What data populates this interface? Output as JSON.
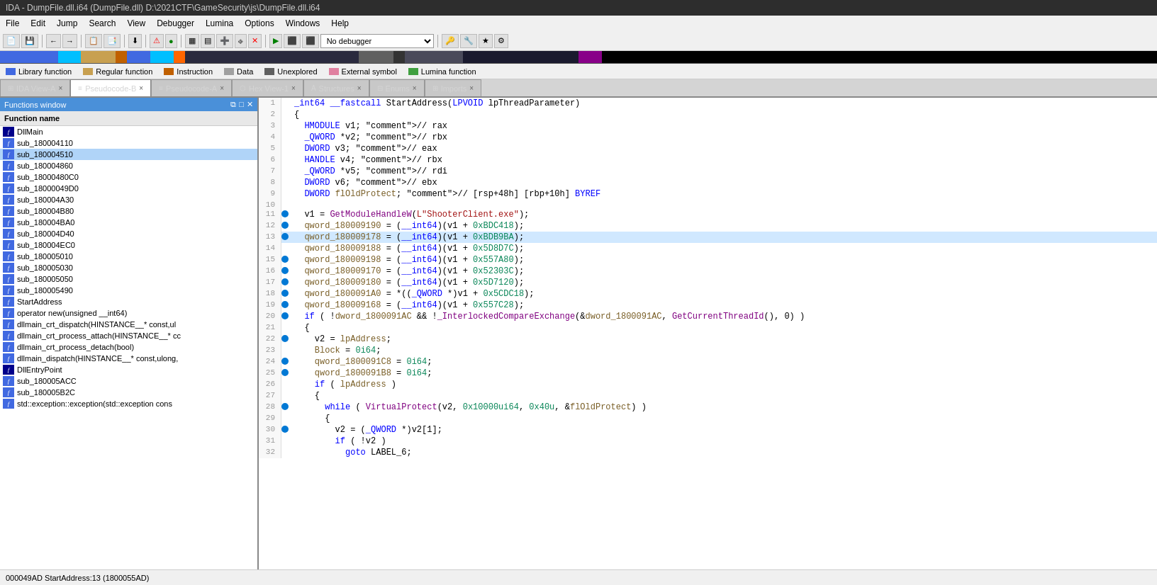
{
  "title": "IDA - DumpFile.dll.i64 (DumpFile.dll) D:\\2021CTF\\GameSecurity\\js\\DumpFile.dll.i64",
  "menu": {
    "items": [
      "File",
      "Edit",
      "Jump",
      "Search",
      "View",
      "Debugger",
      "Lumina",
      "Options",
      "Windows",
      "Help"
    ]
  },
  "legend": {
    "items": [
      {
        "label": "Library function",
        "color": "#4169e1"
      },
      {
        "label": "Regular function",
        "color": "#c8a050"
      },
      {
        "label": "Instruction",
        "color": "#c06000"
      },
      {
        "label": "Data",
        "color": "#a0a0a0"
      },
      {
        "label": "Unexplored",
        "color": "#606060"
      },
      {
        "label": "External symbol",
        "color": "#e080a0"
      },
      {
        "label": "Lumina function",
        "color": "#40a040"
      }
    ]
  },
  "tabs": [
    {
      "label": "IDA View-A",
      "active": false,
      "closeable": true
    },
    {
      "label": "Pseudocode-B",
      "active": true,
      "closeable": true
    },
    {
      "label": "Pseudocode-A",
      "active": false,
      "closeable": true
    },
    {
      "label": "Hex View-1",
      "active": false,
      "closeable": true
    },
    {
      "label": "Structures",
      "active": false,
      "closeable": true
    },
    {
      "label": "Enums",
      "active": false,
      "closeable": true
    },
    {
      "label": "Imports",
      "active": false,
      "closeable": true
    }
  ],
  "sidebar": {
    "title": "Functions window",
    "header": "Function name",
    "items": [
      {
        "name": "DllMain",
        "selected": false,
        "dark": true
      },
      {
        "name": "sub_180004110",
        "selected": false,
        "dark": false
      },
      {
        "name": "sub_180004510",
        "selected": true,
        "dark": false
      },
      {
        "name": "sub_180004860",
        "selected": false,
        "dark": false
      },
      {
        "name": "sub_18000480C0",
        "selected": false,
        "dark": false
      },
      {
        "name": "sub_18000049D0",
        "selected": false,
        "dark": false
      },
      {
        "name": "sub_180004A30",
        "selected": false,
        "dark": false
      },
      {
        "name": "sub_180004B80",
        "selected": false,
        "dark": false
      },
      {
        "name": "sub_180004BA0",
        "selected": false,
        "dark": false
      },
      {
        "name": "sub_180004D40",
        "selected": false,
        "dark": false
      },
      {
        "name": "sub_180004EC0",
        "selected": false,
        "dark": false
      },
      {
        "name": "sub_180005010",
        "selected": false,
        "dark": false
      },
      {
        "name": "sub_180005030",
        "selected": false,
        "dark": false
      },
      {
        "name": "sub_180005050",
        "selected": false,
        "dark": false
      },
      {
        "name": "sub_180005490",
        "selected": false,
        "dark": false
      },
      {
        "name": "StartAddress",
        "selected": false,
        "dark": false
      },
      {
        "name": "operator new(unsigned __int64)",
        "selected": false,
        "dark": false
      },
      {
        "name": "dllmain_crt_dispatch(HINSTANCE__* const,ul",
        "selected": false,
        "dark": false
      },
      {
        "name": "dllmain_crt_process_attach(HINSTANCE__* cc",
        "selected": false,
        "dark": false
      },
      {
        "name": "dllmain_crt_process_detach(bool)",
        "selected": false,
        "dark": false
      },
      {
        "name": "dllmain_dispatch(HINSTANCE__* const,ulong,",
        "selected": false,
        "dark": false
      },
      {
        "name": "DllEntryPoint",
        "selected": false,
        "dark": true
      },
      {
        "name": "sub_180005ACC",
        "selected": false,
        "dark": false
      },
      {
        "name": "sub_180005B2C",
        "selected": false,
        "dark": false
      },
      {
        "name": "std::exception::exception(std::exception cons",
        "selected": false,
        "dark": false
      }
    ]
  },
  "code": {
    "function_sig": "_int64 __fastcall StartAddress(LPVOID lpThreadParameter)",
    "lines": [
      {
        "num": 1,
        "bp": false,
        "hl": false,
        "text": "_int64 __fastcall StartAddress(LPVOID lpThreadParameter)"
      },
      {
        "num": 2,
        "bp": false,
        "hl": false,
        "text": "{"
      },
      {
        "num": 3,
        "bp": false,
        "hl": false,
        "text": "  HMODULE v1; // rax"
      },
      {
        "num": 4,
        "bp": false,
        "hl": false,
        "text": "  _QWORD *v2; // rbx"
      },
      {
        "num": 5,
        "bp": false,
        "hl": false,
        "text": "  DWORD v3; // eax"
      },
      {
        "num": 6,
        "bp": false,
        "hl": false,
        "text": "  HANDLE v4; // rbx"
      },
      {
        "num": 7,
        "bp": false,
        "hl": false,
        "text": "  _QWORD *v5; // rdi"
      },
      {
        "num": 8,
        "bp": false,
        "hl": false,
        "text": "  DWORD v6; // ebx"
      },
      {
        "num": 9,
        "bp": false,
        "hl": false,
        "text": "  DWORD flOldProtect; // [rsp+48h] [rbp+10h] BYREF"
      },
      {
        "num": 10,
        "bp": false,
        "hl": false,
        "text": ""
      },
      {
        "num": 11,
        "bp": true,
        "hl": false,
        "text": "  v1 = GetModuleHandleW(L\"ShooterClient.exe\");"
      },
      {
        "num": 12,
        "bp": true,
        "hl": false,
        "text": "  qword_180009190 = (__int64)(v1 + 0xBDC418);"
      },
      {
        "num": 13,
        "bp": true,
        "hl": true,
        "text": "  qword_180009178 = (__int64)(v1 + 0xBDB9BA);"
      },
      {
        "num": 14,
        "bp": false,
        "hl": false,
        "text": "  qword_180009188 = (__int64)(v1 + 0x5D8D7C);"
      },
      {
        "num": 15,
        "bp": true,
        "hl": false,
        "text": "  qword_180009198 = (__int64)(v1 + 0x557A80);"
      },
      {
        "num": 16,
        "bp": true,
        "hl": false,
        "text": "  qword_180009170 = (__int64)(v1 + 0x52303C);"
      },
      {
        "num": 17,
        "bp": true,
        "hl": false,
        "text": "  qword_180009180 = (__int64)(v1 + 0x5D7120);"
      },
      {
        "num": 18,
        "bp": true,
        "hl": false,
        "text": "  qword_1800091A0 = *((_QWORD *)v1 + 0x5CDC18);"
      },
      {
        "num": 19,
        "bp": true,
        "hl": false,
        "text": "  qword_180009168 = (__int64)(v1 + 0x557C28);"
      },
      {
        "num": 20,
        "bp": true,
        "hl": false,
        "text": "  if ( !dword_1800091AC && !_InterlockedCompareExchange(&dword_1800091AC, GetCurrentThreadId(), 0) )"
      },
      {
        "num": 21,
        "bp": false,
        "hl": false,
        "text": "  {"
      },
      {
        "num": 22,
        "bp": true,
        "hl": false,
        "text": "    v2 = lpAddress;"
      },
      {
        "num": 23,
        "bp": false,
        "hl": false,
        "text": "    Block = 0i64;"
      },
      {
        "num": 24,
        "bp": true,
        "hl": false,
        "text": "    qword_1800091C8 = 0i64;"
      },
      {
        "num": 25,
        "bp": true,
        "hl": false,
        "text": "    qword_1800091B8 = 0i64;"
      },
      {
        "num": 26,
        "bp": false,
        "hl": false,
        "text": "    if ( lpAddress )"
      },
      {
        "num": 27,
        "bp": false,
        "hl": false,
        "text": "    {"
      },
      {
        "num": 28,
        "bp": true,
        "hl": false,
        "text": "      while ( VirtualProtect(v2, 0x10000ui64, 0x40u, &flOldProtect) )"
      },
      {
        "num": 29,
        "bp": false,
        "hl": false,
        "text": "      {"
      },
      {
        "num": 30,
        "bp": true,
        "hl": false,
        "text": "        v2 = (_QWORD *)v2[1];"
      },
      {
        "num": 31,
        "bp": false,
        "hl": false,
        "text": "        if ( !v2 )"
      },
      {
        "num": 32,
        "bp": false,
        "hl": false,
        "text": "          goto LABEL_6;"
      }
    ]
  },
  "status_bar": {
    "text": "000049AD StartAddress:13 (1800055AD)"
  },
  "debugger": {
    "label": "No debugger"
  }
}
